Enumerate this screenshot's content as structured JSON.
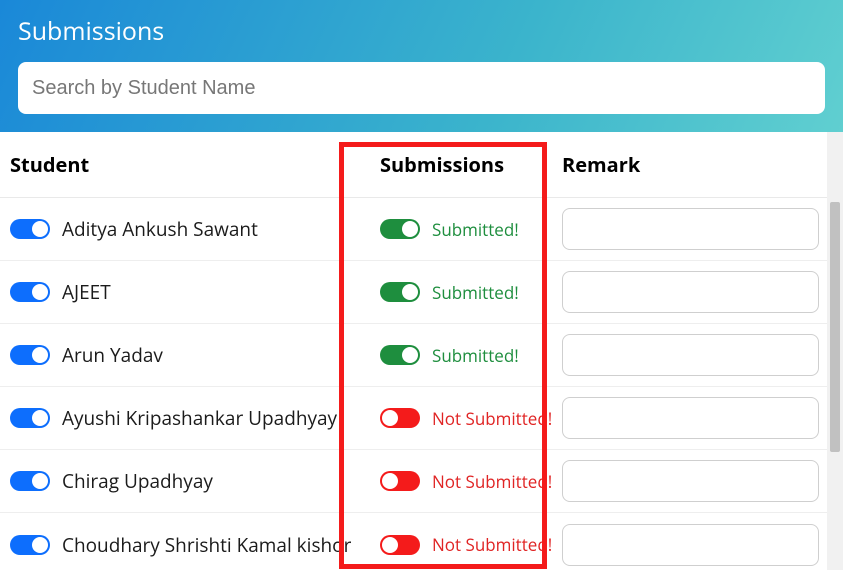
{
  "header": {
    "title": "Submissions"
  },
  "search": {
    "placeholder": "Search by Student Name",
    "value": ""
  },
  "columns": {
    "student": "Student",
    "submissions": "Submissions",
    "remark": "Remark"
  },
  "status_labels": {
    "submitted": "Submitted!",
    "not_submitted": "Not Submitted!"
  },
  "rows": [
    {
      "name": "Aditya Ankush Sawant",
      "submitted": true,
      "remark": ""
    },
    {
      "name": "AJEET",
      "submitted": true,
      "remark": ""
    },
    {
      "name": "Arun Yadav",
      "submitted": true,
      "remark": ""
    },
    {
      "name": "Ayushi Kripashankar Upadhyay",
      "submitted": false,
      "remark": ""
    },
    {
      "name": "Chirag Upadhyay",
      "submitted": false,
      "remark": ""
    },
    {
      "name": "Choudhary Shrishti Kamal kishor",
      "submitted": false,
      "remark": ""
    }
  ]
}
